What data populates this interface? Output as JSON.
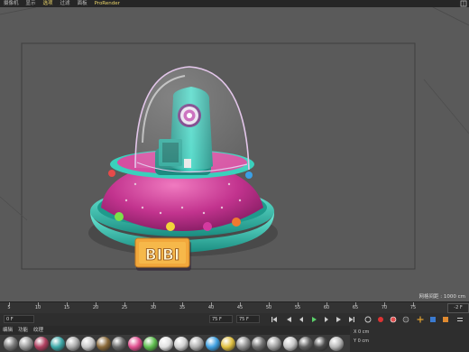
{
  "menu": {
    "items": [
      "摄像机",
      "显示",
      "选项",
      "过滤",
      "面板",
      "ProRender"
    ],
    "active_index": 2
  },
  "viewport": {
    "grid_spacing_label": "网格间距 : 1000 cm",
    "toy_sign_text": "BIBI"
  },
  "timeline": {
    "ticks": [
      "5",
      "10",
      "15",
      "20",
      "25",
      "30",
      "35",
      "40",
      "45",
      "50",
      "55",
      "60",
      "65",
      "70",
      "75"
    ],
    "end_field": "-2 F"
  },
  "playback": {
    "start_field": "0 F",
    "end_field": "75 F",
    "alt_end_field": "75 F"
  },
  "material_bar": {
    "tabs": [
      "编辑",
      "功能",
      "纹理"
    ]
  },
  "coordinates": {
    "rows": [
      "X  0 cm",
      "Y  0 cm"
    ]
  },
  "colors": {
    "ufo_body": "#c2338e",
    "ufo_ring": "#2fc4b0",
    "robot": "#3cc7b7",
    "sign": "#f2a83c",
    "viewport_bg": "#5a5a5a"
  },
  "swatches": [
    "#7a7a7a",
    "#9a9a9a",
    "#b04060",
    "#3da8a8",
    "#aaaaaa",
    "#c9c9c9",
    "#8a6a3a",
    "#6b6b6b",
    "#e05090",
    "#5fbf50",
    "#e0e0e0",
    "#d0d0d0",
    "#b0b0b0",
    "#40a0e0",
    "#e0c040",
    "#909090",
    "#707070",
    "#a0a0a0",
    "#c8c8c8",
    "#606060",
    "#4a4a4a",
    "#b8b8b8"
  ]
}
